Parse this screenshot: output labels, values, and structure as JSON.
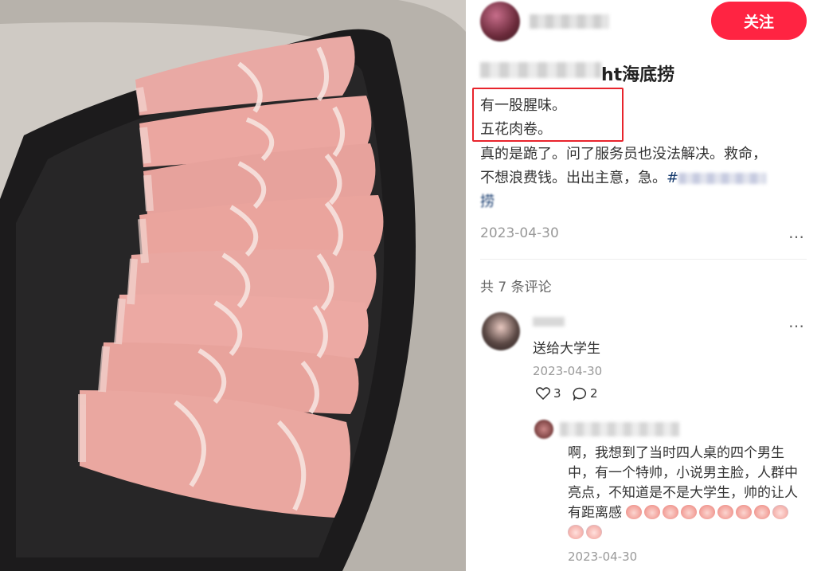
{
  "post": {
    "follow_label": "关注",
    "title_suffix": "ht海底捞",
    "highlight_lines": [
      "有一股腥味。",
      "五花肉卷。"
    ],
    "body_line1": "真的是跪了。问了服务员也没法解决。救命，",
    "body_line2_prefix": "不想浪费钱。出出主意，急。",
    "hashtag_start": "#",
    "hashtag_end": "捞",
    "date": "2023-04-30",
    "more_icon": "…",
    "comment_count": "共 7 条评论"
  },
  "comment": {
    "text": "送给大学生",
    "date": "2023-04-30",
    "likes": "3",
    "replies": "2",
    "more_icon": "…"
  },
  "reply": {
    "text": "啊，我想到了当时四人桌的四个男生中，有一个特帅，小说男主脸，人群中亮点，不知道是不是大学生，帅的让人有距离感",
    "date": "2023-04-30"
  },
  "colors": {
    "accent": "#ff2442",
    "highlight_box": "#e8242c",
    "hashtag": "#13386c"
  }
}
